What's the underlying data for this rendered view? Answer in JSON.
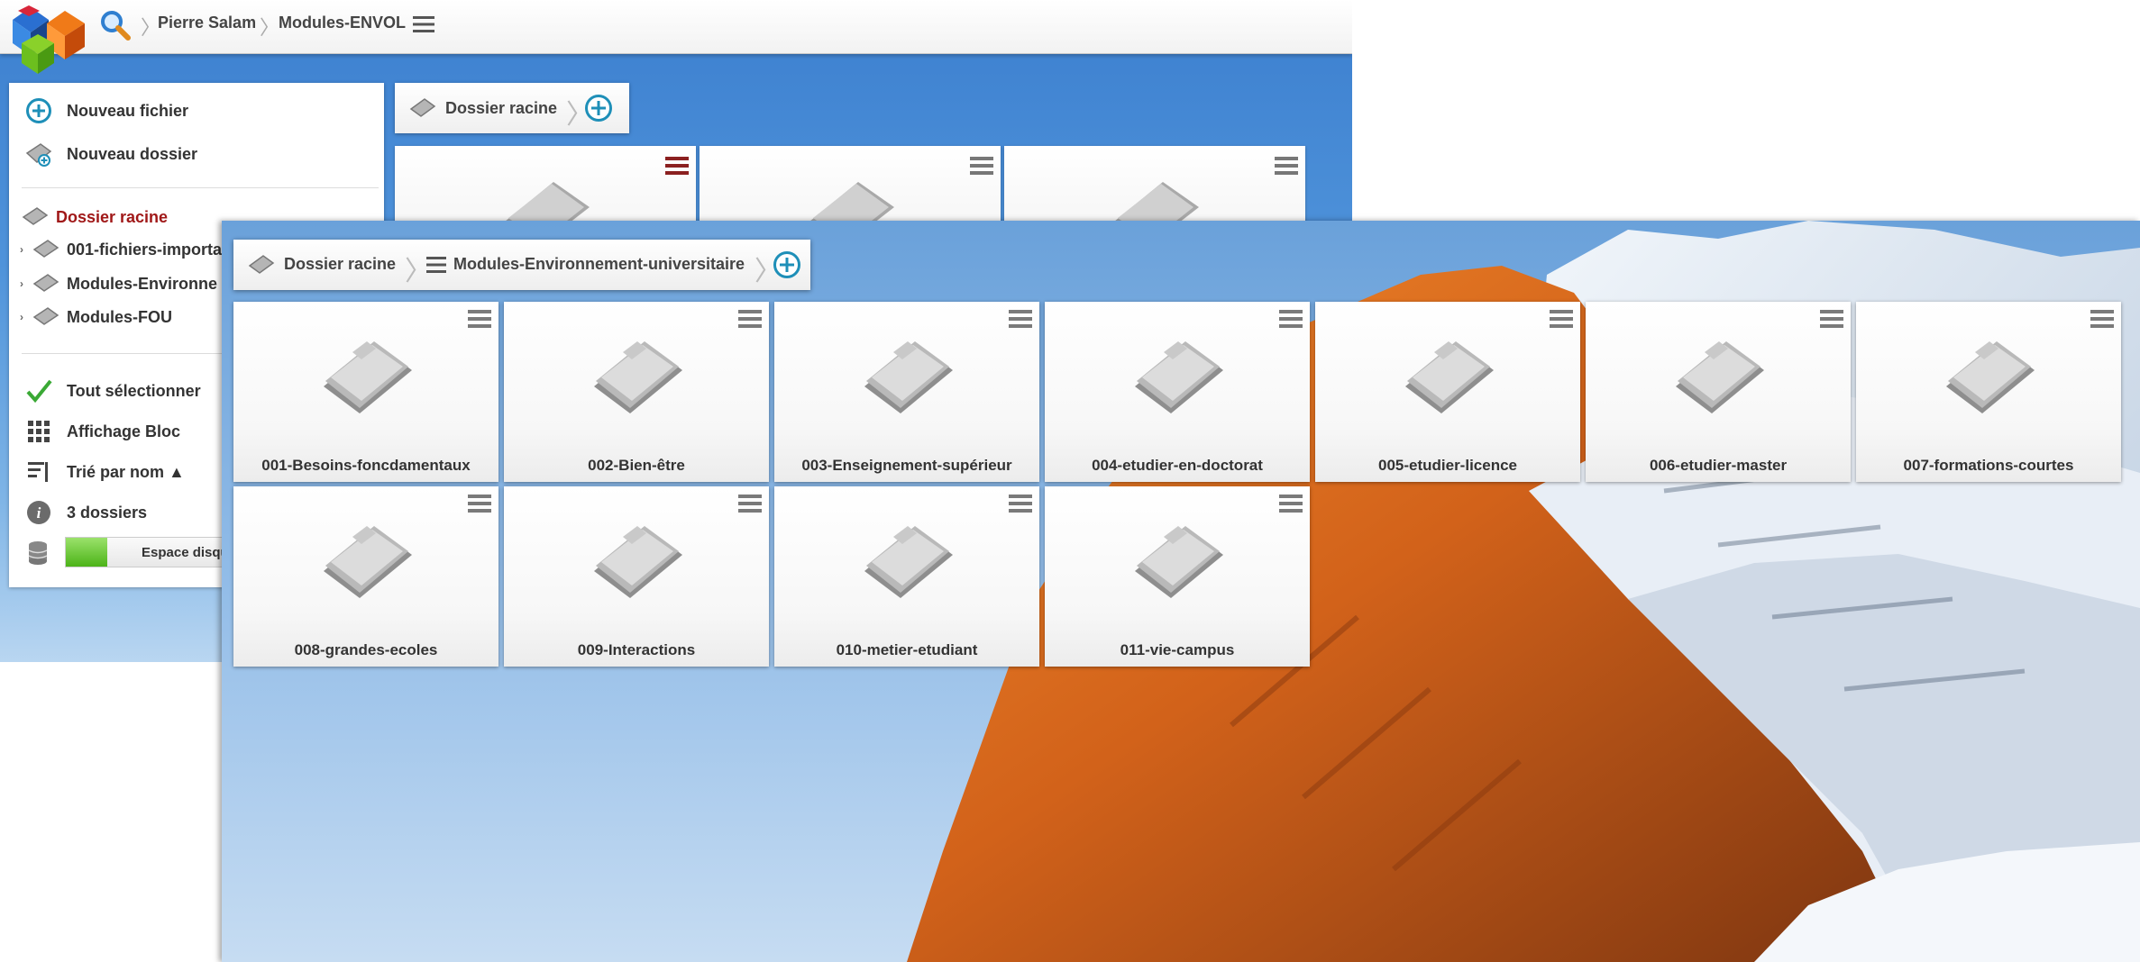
{
  "back_window": {
    "breadcrumb": {
      "user": "Pierre Salam",
      "folder": "Modules-ENVOL"
    },
    "panel": {
      "new_file": "Nouveau fichier",
      "new_folder": "Nouveau dossier",
      "tree_root": "Dossier racine",
      "tree_items": [
        "001-fichiers-importa",
        "Modules-Environne",
        "Modules-FOU"
      ],
      "select_all": "Tout sélectionner",
      "display_mode": "Affichage Bloc",
      "sort": "Trié par nom ▲",
      "folder_count": "3 dossiers",
      "disk_space": "Espace disque"
    },
    "crumbbar": {
      "root": "Dossier racine"
    }
  },
  "front_window": {
    "crumbbar": {
      "root": "Dossier racine",
      "current": "Modules-Environnement-universitaire"
    },
    "folders": [
      "001-Besoins-foncdamentaux",
      "002-Bien-être",
      "003-Enseignement-supérieur",
      "004-etudier-en-doctorat",
      "005-etudier-licence",
      "006-etudier-master",
      "007-formations-courtes",
      "008-grandes-ecoles",
      "009-Interactions",
      "010-metier-etudiant",
      "011-vie-campus"
    ]
  },
  "colors": {
    "accent": "#1e8fb8",
    "root_link": "#a01818",
    "disk_fill": "#5cc02a"
  },
  "icons": [
    "logo-icon",
    "search-icon",
    "hamburger-icon",
    "add-circle-icon",
    "folder-icon",
    "checkmark-icon",
    "grid-icon",
    "sort-icon",
    "info-icon",
    "database-icon"
  ]
}
